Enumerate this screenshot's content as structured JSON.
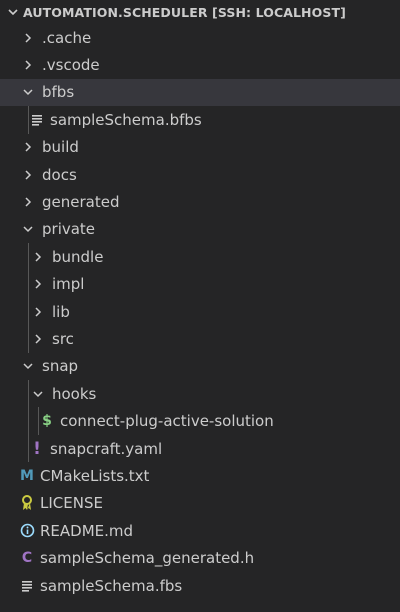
{
  "explorer": {
    "title": "AUTOMATION.SCHEDULER [SSH: LOCALHOST]"
  },
  "tree": [
    {
      "label": ".cache",
      "kind": "folder",
      "expanded": false,
      "depth": 0
    },
    {
      "label": ".vscode",
      "kind": "folder",
      "expanded": false,
      "depth": 0
    },
    {
      "label": "bfbs",
      "kind": "folder",
      "expanded": true,
      "depth": 0,
      "selected": true
    },
    {
      "label": "sampleSchema.bfbs",
      "kind": "file",
      "icon": "lines-file-icon",
      "depth": 1
    },
    {
      "label": "build",
      "kind": "folder",
      "expanded": false,
      "depth": 0
    },
    {
      "label": "docs",
      "kind": "folder",
      "expanded": false,
      "depth": 0
    },
    {
      "label": "generated",
      "kind": "folder",
      "expanded": false,
      "depth": 0
    },
    {
      "label": "private",
      "kind": "folder",
      "expanded": true,
      "depth": 0
    },
    {
      "label": "bundle",
      "kind": "folder",
      "expanded": false,
      "depth": 1
    },
    {
      "label": "impl",
      "kind": "folder",
      "expanded": false,
      "depth": 1
    },
    {
      "label": "lib",
      "kind": "folder",
      "expanded": false,
      "depth": 1
    },
    {
      "label": "src",
      "kind": "folder",
      "expanded": false,
      "depth": 1
    },
    {
      "label": "snap",
      "kind": "folder",
      "expanded": true,
      "depth": 0
    },
    {
      "label": "hooks",
      "kind": "folder",
      "expanded": true,
      "depth": 1
    },
    {
      "label": "connect-plug-active-solution",
      "kind": "file",
      "icon": "shell-dollar-icon",
      "depth": 2
    },
    {
      "label": "snapcraft.yaml",
      "kind": "file",
      "icon": "yaml-exclamation-icon",
      "depth": 1
    },
    {
      "label": "CMakeLists.txt",
      "kind": "file",
      "icon": "cmake-m-icon",
      "depth": 0
    },
    {
      "label": "LICENSE",
      "kind": "file",
      "icon": "license-ribbon-icon",
      "depth": 0
    },
    {
      "label": "README.md",
      "kind": "file",
      "icon": "info-circle-icon",
      "depth": 0
    },
    {
      "label": "sampleSchema_generated.h",
      "kind": "file",
      "icon": "c-header-icon",
      "depth": 0
    },
    {
      "label": "sampleSchema.fbs",
      "kind": "file",
      "icon": "lines-file-icon",
      "depth": 0
    }
  ],
  "colors": {
    "background": "#252526",
    "selected_row": "#37373d",
    "text": "#cccccc",
    "indent_guide": "#585858",
    "shell_icon": "#89d185",
    "yaml_icon": "#a074c4",
    "cmake_icon": "#519aba",
    "license_icon": "#cbcb41",
    "info_icon": "#9cdcfe",
    "c_icon": "#a074c4"
  }
}
